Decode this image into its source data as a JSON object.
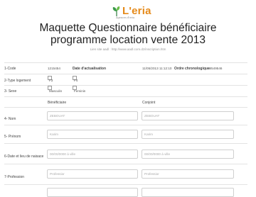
{
  "logo": {
    "brand_main": "L'eria",
    "tagline": "Agences d'eria"
  },
  "page": {
    "title": "Maquette Questionnaire bénéficiaire programme location vente 2013",
    "link_text": "Lien site aadl : http://www.aadl.com.dz/inscription.htm"
  },
  "form": {
    "code_label": "1-Code",
    "code_value": "1215454",
    "date_label": "Date d'actualisation",
    "date_value": "11/05/2013 11:12:10",
    "ordre_label": "Ordre chronologique",
    "ordre_value": "68549546",
    "type_label": "2-Type logement",
    "type_options": [
      "F3",
      "F4"
    ],
    "sexe_label": "3- Sexe",
    "sexe_options": [
      "Masculin",
      "Feminin"
    ],
    "col_beneficiaire": "Bénéficiaire",
    "col_conjoint": "Conjoint",
    "nom_label": "4- Nom",
    "nom_benef": "ZEBOUAT",
    "nom_conj": "ZEBOUAT",
    "prenom_label": "5- Prénom",
    "prenom_benef": "Karim",
    "prenom_conj": "Karim",
    "naissance_label": "6-Date et lieu de naisace",
    "naissance_benef": "00/00/0000 à ville",
    "naissance_conj": "00/00/0000 à ville",
    "profession_label": "7-Profession",
    "profession_benef": "Professior",
    "profession_conj": "Professior"
  }
}
